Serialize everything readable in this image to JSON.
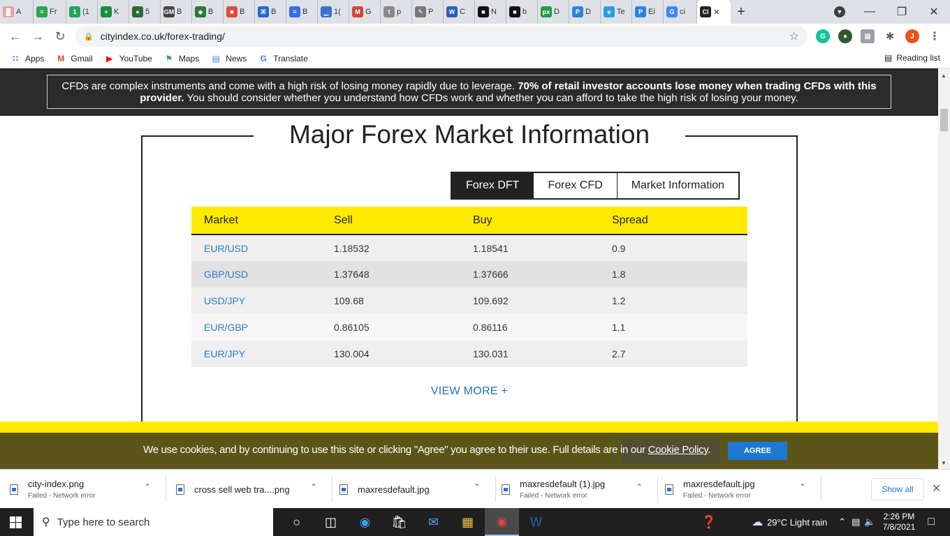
{
  "browser": {
    "tabs": [
      {
        "label": "A",
        "color": "#e9a1a1",
        "glyph": "█"
      },
      {
        "label": "Fr",
        "color": "#2ea44f",
        "glyph": "≡"
      },
      {
        "label": "(1",
        "color": "#22a35a",
        "glyph": "1"
      },
      {
        "label": "K",
        "color": "#1b8e3e",
        "glyph": "+"
      },
      {
        "label": "5",
        "color": "#2a6b3a",
        "glyph": "●"
      },
      {
        "label": "B",
        "color": "#444",
        "glyph": "GM"
      },
      {
        "label": "B",
        "color": "#2a7a3a",
        "glyph": "◆"
      },
      {
        "label": "B",
        "color": "#e24a3b",
        "glyph": "■"
      },
      {
        "label": "B",
        "color": "#2968c8",
        "glyph": "⌘"
      },
      {
        "label": "B",
        "color": "#3a6ee0",
        "glyph": "≡"
      },
      {
        "label": "1(",
        "color": "#3b71d0",
        "glyph": "▁"
      },
      {
        "label": "G",
        "color": "#d44638",
        "glyph": "M"
      },
      {
        "label": "p",
        "color": "#888",
        "glyph": "t"
      },
      {
        "label": "P",
        "color": "#777",
        "glyph": "✎"
      },
      {
        "label": "C",
        "color": "#2b5fb3",
        "glyph": "W"
      },
      {
        "label": "N",
        "color": "#111",
        "glyph": "■"
      },
      {
        "label": "b",
        "color": "#111",
        "glyph": "■"
      },
      {
        "label": "D",
        "color": "#1e9b4a",
        "glyph": "px"
      },
      {
        "label": "D",
        "color": "#2d84e0",
        "glyph": "P"
      },
      {
        "label": "Te",
        "color": "#29a0e0",
        "glyph": "e"
      },
      {
        "label": "Ei",
        "color": "#2d84e0",
        "glyph": "P"
      },
      {
        "label": "ci",
        "color": "#4285f4",
        "glyph": "G"
      }
    ],
    "active_tab_glyph": "CI",
    "new_tab": "+",
    "url": "cityindex.co.uk/forex-trading/",
    "bookmarks": [
      {
        "label": "Apps",
        "glyph": "∷",
        "color": "#4285f4"
      },
      {
        "label": "Gmail",
        "glyph": "M",
        "color": "#d44638"
      },
      {
        "label": "YouTube",
        "glyph": "▶",
        "color": "#ff0000"
      },
      {
        "label": "Maps",
        "glyph": "⚑",
        "color": "#34a853"
      },
      {
        "label": "News",
        "glyph": "▤",
        "color": "#4285f4"
      },
      {
        "label": "Translate",
        "glyph": "G",
        "color": "#4285f4"
      }
    ],
    "reading_list": "Reading list",
    "profile_initial": "J"
  },
  "risk_warning": {
    "part1": "CFDs are complex instruments and come with a high risk of losing money rapidly due to leverage.",
    "bold": "70% of retail investor accounts lose money when trading CFDs with this provider.",
    "part2": "You should consider whether you understand how CFDs work and whether you can afford to take the high risk of losing your money."
  },
  "market": {
    "title": "Major Forex Market Information",
    "tabs": [
      "Forex DFT",
      "Forex CFD",
      "Market Information"
    ],
    "columns": [
      "Market",
      "Sell",
      "Buy",
      "Spread"
    ],
    "rows": [
      [
        "EUR/USD",
        "1.18532",
        "1.18541",
        "0.9"
      ],
      [
        "GBP/USD",
        "1.37648",
        "1.37666",
        "1.8"
      ],
      [
        "USD/JPY",
        "109.68",
        "109.692",
        "1.2"
      ],
      [
        "EUR/GBP",
        "0.86105",
        "0.86116",
        "1.1"
      ],
      [
        "EUR/JPY",
        "130.004",
        "130.031",
        "2.7"
      ]
    ],
    "view_more": "VIEW MORE +"
  },
  "cookie": {
    "text": "We use cookies, and by continuing to use this site or clicking \"Agree\" you agree to their use. Full details are in our",
    "link": "Cookie Policy",
    "agree": "AGREE"
  },
  "downloads": [
    {
      "name": "city-index.png",
      "status": "Failed - Network error"
    },
    {
      "name": "cross sell web tra....png",
      "status": ""
    },
    {
      "name": "maxresdefault.jpg",
      "status": ""
    },
    {
      "name": "maxresdefault (1).jpg",
      "status": "Failed - Network error"
    },
    {
      "name": "maxresdefault.jpg",
      "status": "Failed - Network error"
    }
  ],
  "downloads_show_all": "Show all",
  "taskbar": {
    "search_placeholder": "Type here to search",
    "weather": "29°C  Light rain",
    "time": "2:26 PM",
    "date": "7/8/2021"
  }
}
